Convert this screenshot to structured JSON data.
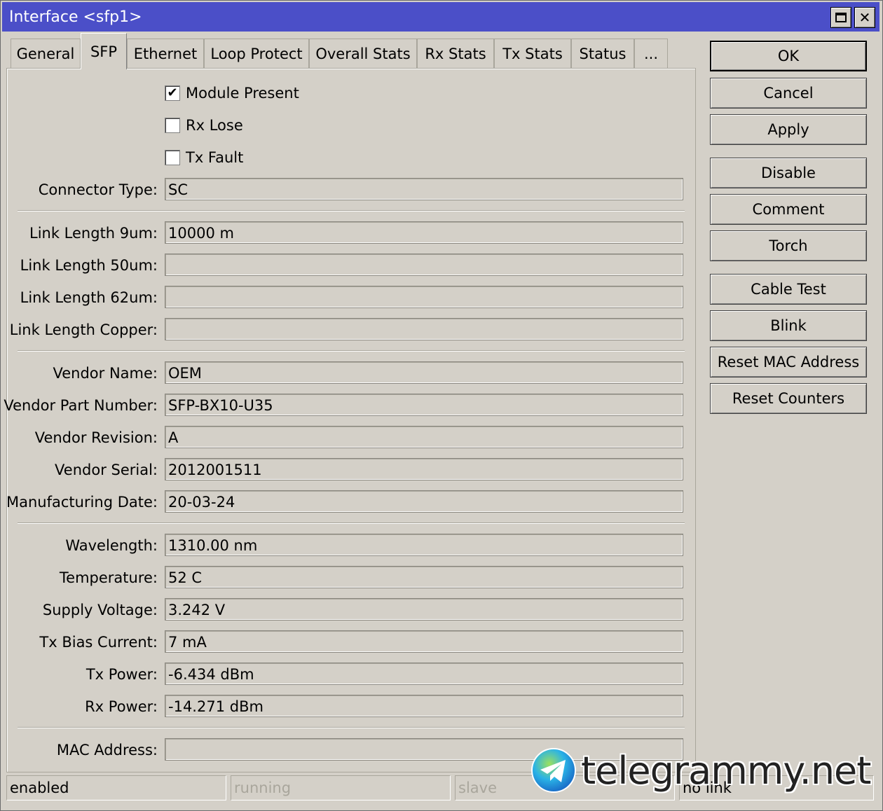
{
  "window": {
    "title": "Interface <sfp1>"
  },
  "tabs": [
    {
      "label": "General"
    },
    {
      "label": "SFP"
    },
    {
      "label": "Ethernet"
    },
    {
      "label": "Loop Protect"
    },
    {
      "label": "Overall Stats"
    },
    {
      "label": "Rx Stats"
    },
    {
      "label": "Tx Stats"
    },
    {
      "label": "Status"
    },
    {
      "label": "..."
    }
  ],
  "checkboxes": {
    "module_present": {
      "label": "Module Present",
      "checked": true
    },
    "rx_lose": {
      "label": "Rx Lose",
      "checked": false
    },
    "tx_fault": {
      "label": "Tx Fault",
      "checked": false
    }
  },
  "fields": {
    "connector_type": {
      "label": "Connector Type:",
      "value": "SC"
    },
    "link_length_9um": {
      "label": "Link Length 9um:",
      "value": "10000 m"
    },
    "link_length_50um": {
      "label": "Link Length 50um:",
      "value": ""
    },
    "link_length_62um": {
      "label": "Link Length 62um:",
      "value": ""
    },
    "link_length_copper": {
      "label": "Link Length Copper:",
      "value": ""
    },
    "vendor_name": {
      "label": "Vendor Name:",
      "value": "OEM"
    },
    "vendor_part_number": {
      "label": "Vendor Part Number:",
      "value": "SFP-BX10-U35"
    },
    "vendor_revision": {
      "label": "Vendor Revision:",
      "value": "A"
    },
    "vendor_serial": {
      "label": "Vendor Serial:",
      "value": "2012001511"
    },
    "manufacturing_date": {
      "label": "Manufacturing Date:",
      "value": "20-03-24"
    },
    "wavelength": {
      "label": "Wavelength:",
      "value": "1310.00 nm"
    },
    "temperature": {
      "label": "Temperature:",
      "value": "52 C"
    },
    "supply_voltage": {
      "label": "Supply Voltage:",
      "value": "3.242 V"
    },
    "tx_bias_current": {
      "label": "Tx Bias Current:",
      "value": "7 mA"
    },
    "tx_power": {
      "label": "Tx Power:",
      "value": "-6.434 dBm"
    },
    "rx_power": {
      "label": "Rx Power:",
      "value": "-14.271 dBm"
    },
    "mac_address": {
      "label": "MAC Address:",
      "value": ""
    }
  },
  "buttons": {
    "ok": "OK",
    "cancel": "Cancel",
    "apply": "Apply",
    "disable": "Disable",
    "comment": "Comment",
    "torch": "Torch",
    "cable_test": "Cable Test",
    "blink": "Blink",
    "reset_mac": "Reset MAC Address",
    "reset_counters": "Reset Counters"
  },
  "statusbar": {
    "state": "enabled",
    "running": "running",
    "slave": "slave",
    "link": "no link"
  },
  "watermark": {
    "text": "telegrammy.net"
  },
  "colors": {
    "titlebar": "#4b4fc8",
    "face": "#d4d0c8"
  }
}
